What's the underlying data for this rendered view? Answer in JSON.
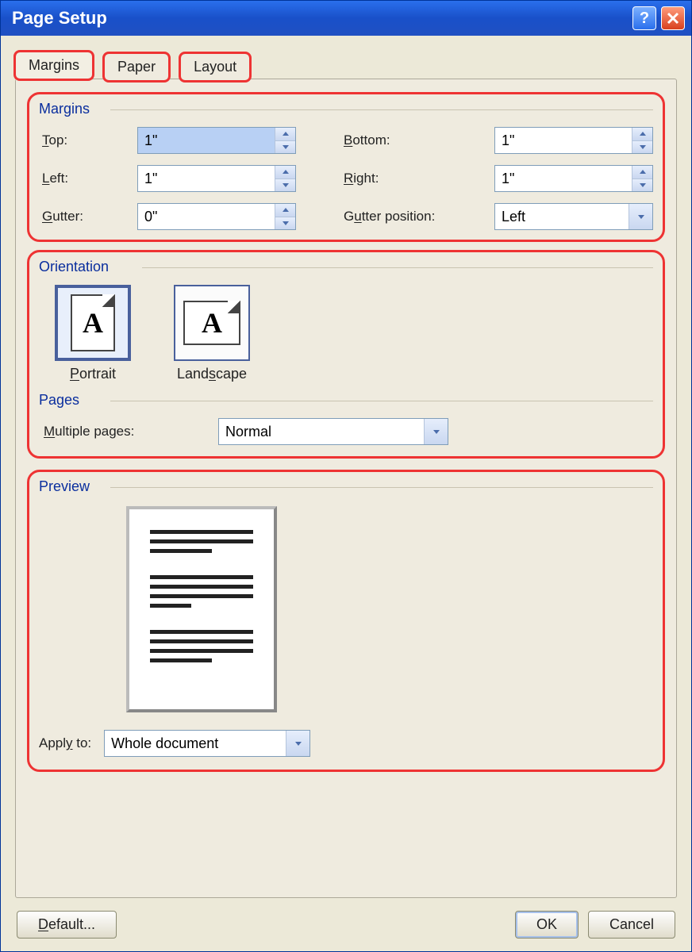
{
  "titlebar": {
    "title": "Page Setup"
  },
  "tabs": {
    "margins": "Margins",
    "paper": "Paper",
    "layout": "Layout"
  },
  "groups": {
    "margins": "Margins",
    "orientation": "Orientation",
    "pages": "Pages",
    "preview": "Preview"
  },
  "margins": {
    "top_label": "Top:",
    "top_value": "1\"",
    "bottom_label": "Bottom:",
    "bottom_value": "1\"",
    "left_label": "Left:",
    "left_value": "1\"",
    "right_label": "Right:",
    "right_value": "1\"",
    "gutter_label": "Gutter:",
    "gutter_value": "0\"",
    "gutterpos_label": "Gutter position:",
    "gutterpos_value": "Left"
  },
  "orientation": {
    "portrait": "Portrait",
    "landscape": "Landscape",
    "selected": "Portrait"
  },
  "pages": {
    "multiple_label": "Multiple pages:",
    "multiple_value": "Normal"
  },
  "applyto": {
    "label": "Apply to:",
    "value": "Whole document"
  },
  "buttons": {
    "default": "Default...",
    "ok": "OK",
    "cancel": "Cancel"
  }
}
